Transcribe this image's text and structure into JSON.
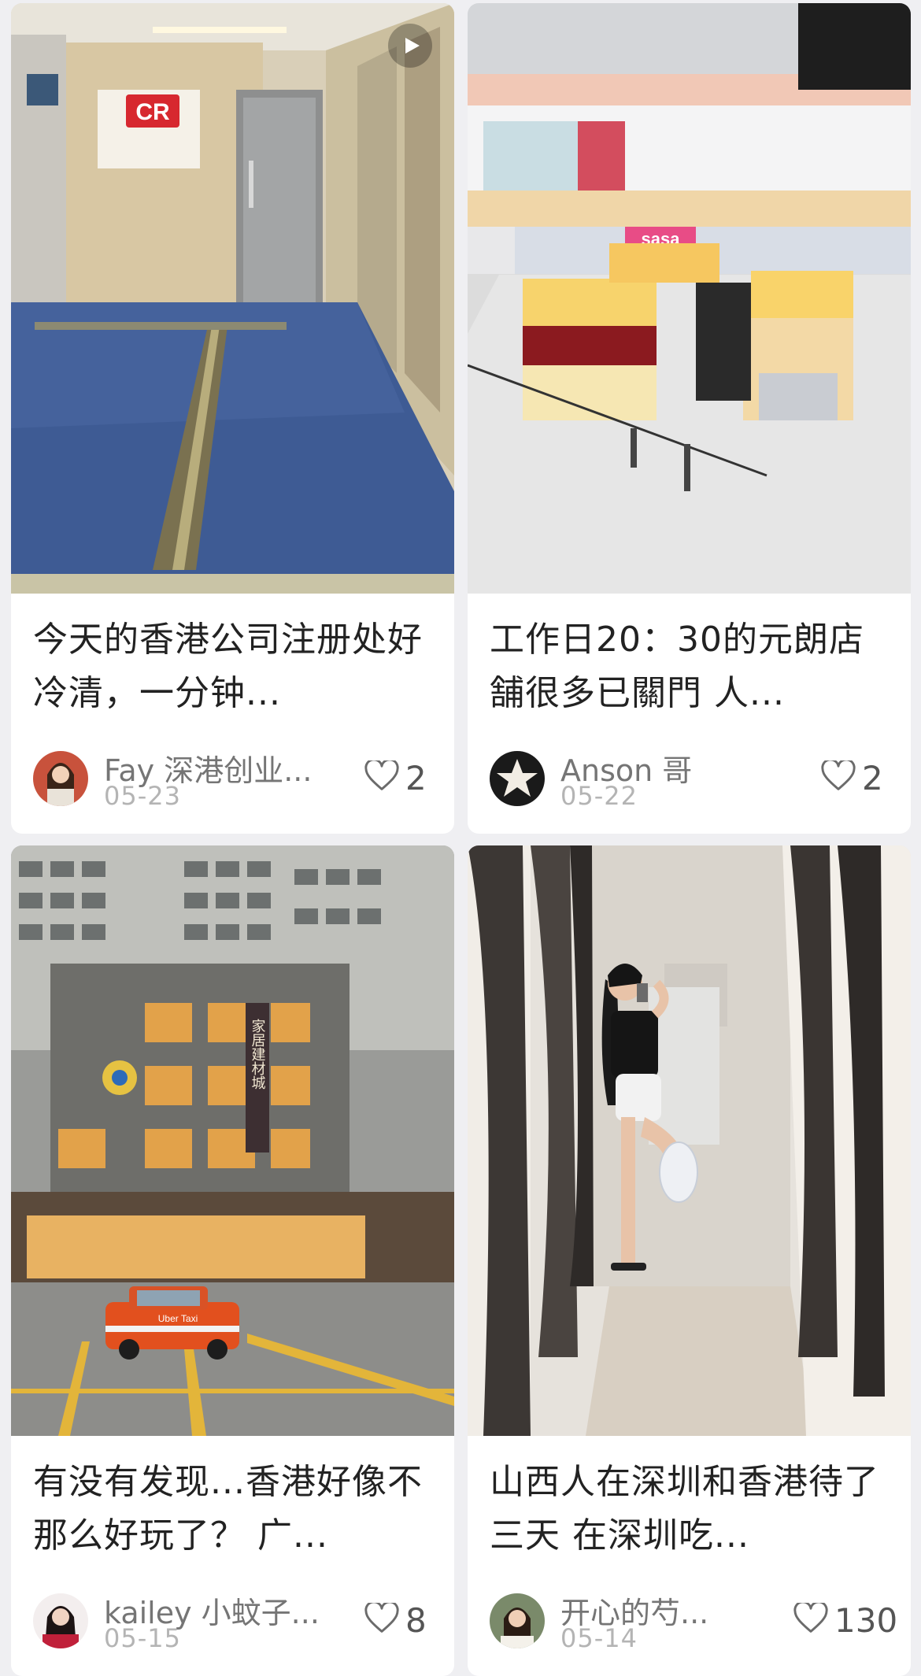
{
  "feed": {
    "cards": [
      {
        "title": "今天的香港公司注册处好冷清，一分钟...",
        "author": "Fay 深港创业...",
        "date": "05-23",
        "likes": "2",
        "is_video": true,
        "sign_text": "CR"
      },
      {
        "title": "工作日20：30的元朗店舗很多已關門 人...",
        "author": "Anson 哥",
        "date": "05-22",
        "likes": "2",
        "is_video": false,
        "store_sign": "sasa"
      },
      {
        "title": "有没有发现...香港好像不那么好玩了？ 广...",
        "author": "kailey 小蚊子...",
        "date": "05-15",
        "likes": "8",
        "is_video": false,
        "building_sign": "家居建材城",
        "taxi_text": "Uber Taxi"
      },
      {
        "title": "山西人在深圳和香港待了三天 在深圳吃...",
        "author": "开心的芍...",
        "date": "05-14",
        "likes": "130",
        "is_video": false
      }
    ]
  },
  "icons": {
    "like": "heart-outline-icon",
    "video": "play-icon"
  },
  "colors": {
    "background": "#efeff2",
    "title": "#222222",
    "author": "#757575",
    "date": "#b4b4b4"
  }
}
